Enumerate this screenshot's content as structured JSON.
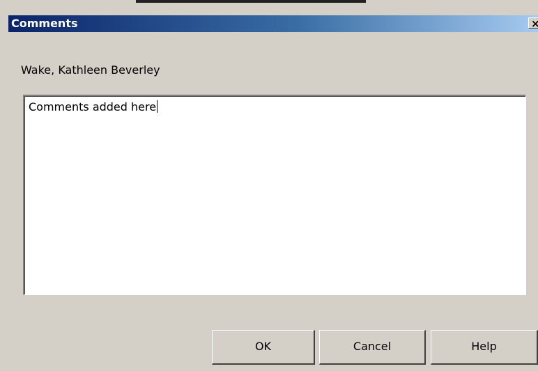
{
  "window": {
    "title": "Comments",
    "close_glyph": "×",
    "titlebar_colors": [
      "#0a246a",
      "#3a6ea5",
      "#a6caf0"
    ]
  },
  "dialog": {
    "name_label": "Wake, Kathleen Beverley",
    "comment_value": "Comments added here"
  },
  "buttons": {
    "ok_label": "OK",
    "cancel_label": "Cancel",
    "help_label": "Help"
  }
}
